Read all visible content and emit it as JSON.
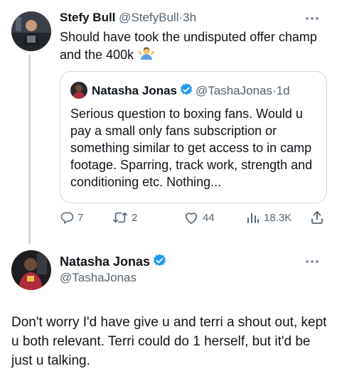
{
  "colors": {
    "text": "#0f1419",
    "muted": "#536471",
    "verified": "#1d9bf0",
    "border": "#cfd9de"
  },
  "tweet1": {
    "name": "Stefy Bull",
    "handle": "@StefyBull",
    "dot": "·",
    "time": "3h",
    "text": "Should have took the undisputed offer champ and the 400k",
    "emoji": "person-shrugging-emoji",
    "quote": {
      "name": "Natasha Jonas",
      "handle": "@TashaJonas",
      "dot": "·",
      "time": "1d",
      "text": "Serious question to boxing fans. Would u pay a small only fans subscription or something similar to get access to in camp footage. Sparring, track work, strength and conditioning etc. Nothing..."
    },
    "actions": {
      "replies": "7",
      "retweets": "2",
      "likes": "44",
      "views": "18.3K"
    }
  },
  "tweet2": {
    "name": "Natasha Jonas",
    "handle": "@TashaJonas",
    "text": "Don't worry I'd have give u and terri a shout out, kept u both relevant. Terri could do 1 herself, but it'd be just u talking."
  }
}
